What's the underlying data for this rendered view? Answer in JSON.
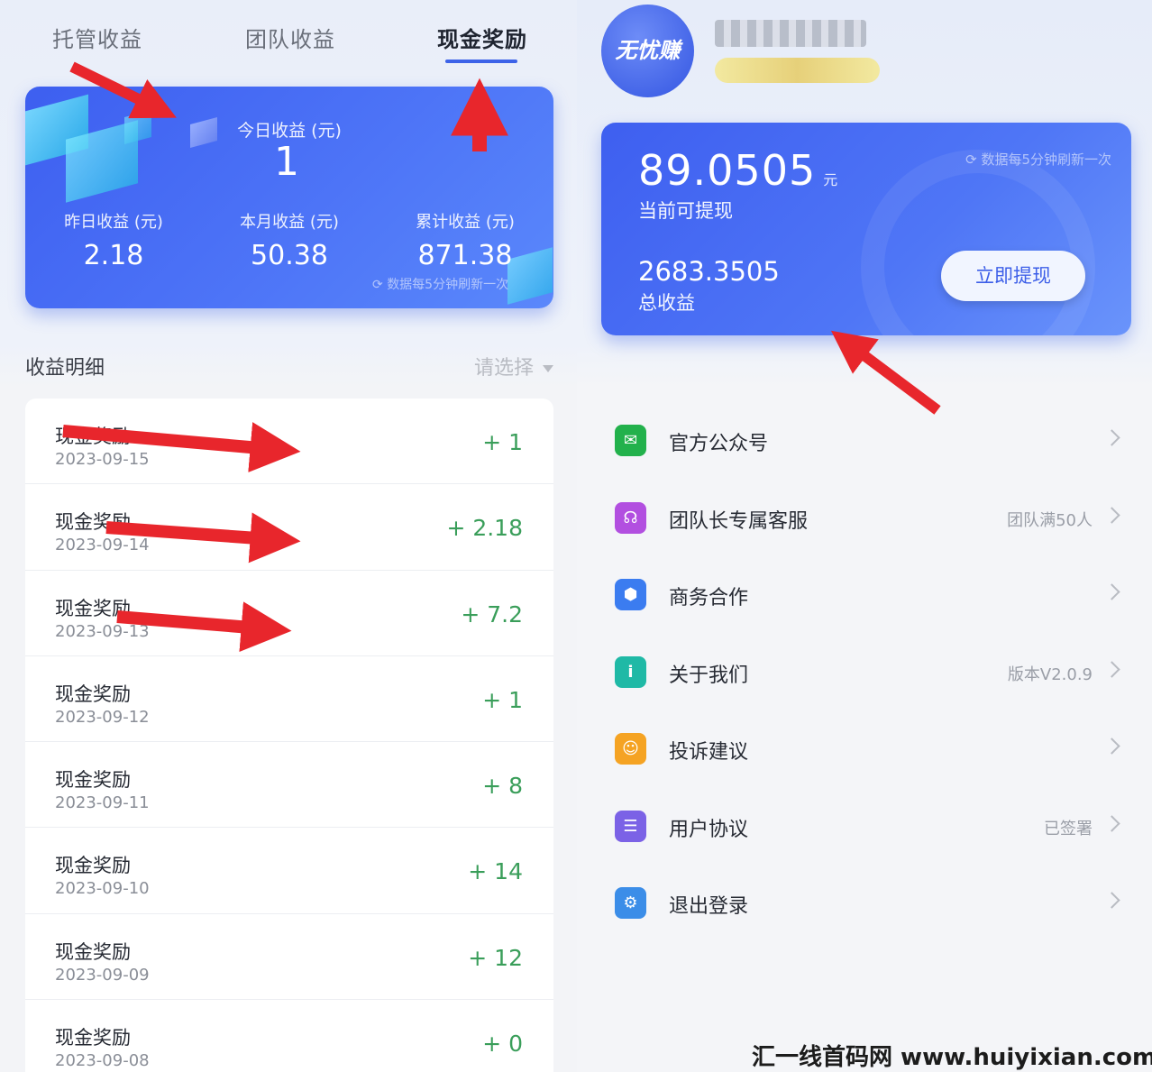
{
  "left": {
    "tabs": [
      {
        "label": "托管收益"
      },
      {
        "label": "团队收益"
      },
      {
        "label": "现金奖励",
        "active": true
      }
    ],
    "card": {
      "today_label": "今日收益 (元)",
      "today_value": "1",
      "yesterday_label": "昨日收益 (元)",
      "yesterday_value": "2.18",
      "month_label": "本月收益 (元)",
      "month_value": "50.38",
      "total_label": "累计收益 (元)",
      "total_value": "871.38",
      "refresh_note": "数据每5分钟刷新一次"
    },
    "detail": {
      "title": "收益明细",
      "select_placeholder": "请选择"
    },
    "records": [
      {
        "name": "现金奖励",
        "date": "2023-09-15",
        "amount": "+ 1"
      },
      {
        "name": "现金奖励",
        "date": "2023-09-14",
        "amount": "+ 2.18"
      },
      {
        "name": "现金奖励",
        "date": "2023-09-13",
        "amount": "+ 7.2"
      },
      {
        "name": "现金奖励",
        "date": "2023-09-12",
        "amount": "+ 1"
      },
      {
        "name": "现金奖励",
        "date": "2023-09-11",
        "amount": "+ 8"
      },
      {
        "name": "现金奖励",
        "date": "2023-09-10",
        "amount": "+ 14"
      },
      {
        "name": "现金奖励",
        "date": "2023-09-09",
        "amount": "+ 12"
      },
      {
        "name": "现金奖励",
        "date": "2023-09-08",
        "amount": "+ 0"
      }
    ]
  },
  "right": {
    "logo_text": "无忧赚",
    "wallet": {
      "available": "89.0505",
      "unit": "元",
      "available_label": "当前可提现",
      "refresh_note": "数据每5分钟刷新一次",
      "total": "2683.3505",
      "total_label": "总收益",
      "withdraw_label": "立即提现"
    },
    "menu": [
      {
        "label": "官方公众号",
        "extra": "",
        "icon": "wechat-icon",
        "color": "#22b14c"
      },
      {
        "label": "团队长专属客服",
        "extra": "团队满50人",
        "icon": "headset-icon",
        "color": "#b24fe0"
      },
      {
        "label": "商务合作",
        "extra": "",
        "icon": "handshake-icon",
        "color": "#3b7cf0"
      },
      {
        "label": "关于我们",
        "extra": "版本V2.0.9",
        "icon": "info-icon",
        "color": "#1fb9a6"
      },
      {
        "label": "投诉建议",
        "extra": "",
        "icon": "smile-chat-icon",
        "color": "#f5a323"
      },
      {
        "label": "用户协议",
        "extra": "已签署",
        "icon": "clipboard-icon",
        "color": "#7b62e6"
      },
      {
        "label": "退出登录",
        "extra": "",
        "icon": "gear-icon",
        "color": "#3b8de8"
      }
    ]
  },
  "watermark": "汇一线首码网 www.huiyixian.com"
}
